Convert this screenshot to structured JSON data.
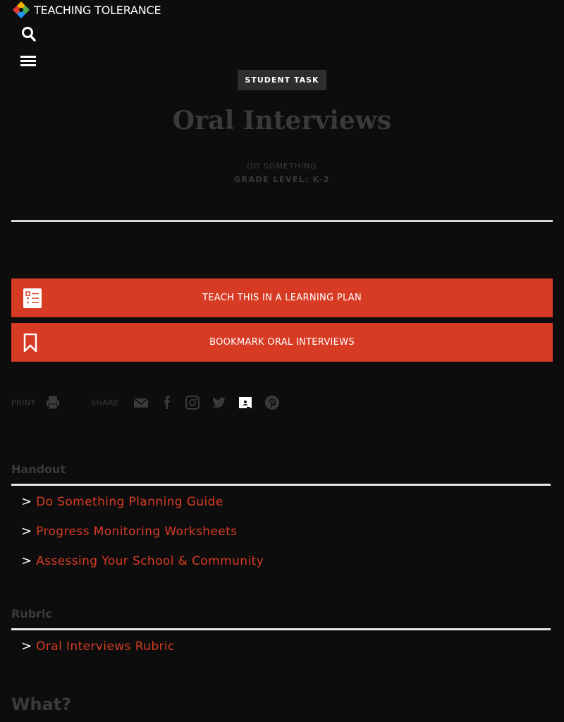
{
  "header": {
    "logo_text": "TEACHING TOLERANCE",
    "search_icon": "search-icon",
    "menu_icon": "hamburger-menu-icon"
  },
  "hero": {
    "badge": "STUDENT TASK",
    "title": "Oral Interviews",
    "category": "DO SOMETHING",
    "grade_level": "GRADE LEVEL: K-2"
  },
  "actions": {
    "learning_plan_label": "TEACH THIS IN A LEARNING PLAN",
    "bookmark_label": "BOOKMARK ORAL INTERVIEWS"
  },
  "share": {
    "print_label": "PRINT",
    "share_label": "SHARE",
    "icons": [
      "printer-icon",
      "email-icon",
      "facebook-icon",
      "instagram-icon",
      "twitter-icon",
      "google-classroom-icon",
      "pinterest-icon"
    ]
  },
  "handout": {
    "heading": "Handout",
    "links": [
      "Do Something Planning Guide",
      "Progress Monitoring Worksheets",
      "Assessing Your School & Community"
    ]
  },
  "rubric": {
    "heading": "Rubric",
    "links": [
      "Oral Interviews Rubric"
    ]
  },
  "what_heading": "What?",
  "colors": {
    "accent": "#d73b24",
    "background": "#0d0d0d",
    "muted_text": "#3a3a3a"
  }
}
